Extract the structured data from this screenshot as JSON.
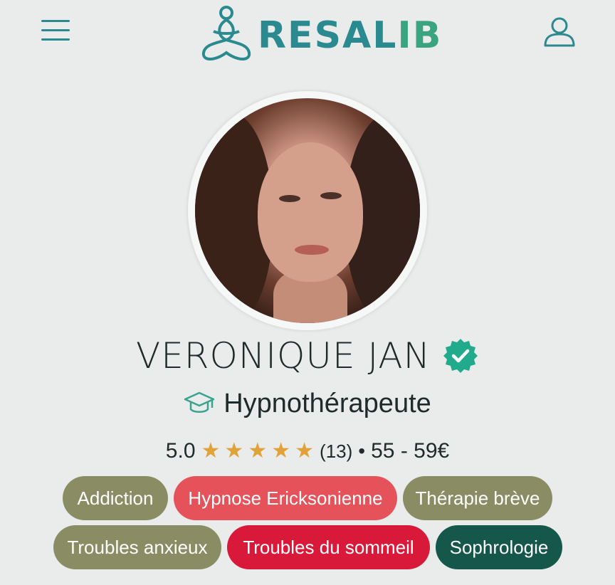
{
  "header": {
    "brand": "RESALIB",
    "brand_part1": "RESAL",
    "brand_part2": "IB",
    "menu_icon": "hamburger-menu-icon",
    "user_icon": "user-account-icon",
    "colors": {
      "teal": "#2a8a8f",
      "green": "#3aa37f"
    }
  },
  "profile": {
    "name": "VERONIQUE JAN",
    "verified_icon": "verified-badge-icon",
    "profession": "Hypnothérapeute",
    "profession_icon": "graduation-cap-icon",
    "rating": "5.0",
    "stars": 5,
    "reviews": "(13)",
    "separator": "•",
    "price": "55 - 59€"
  },
  "tags": [
    {
      "label": "Addiction",
      "color": "#8a8d64"
    },
    {
      "label": "Hypnose Ericksonienne",
      "color": "#e6525a"
    },
    {
      "label": "Thérapie brève",
      "color": "#8a8d64"
    },
    {
      "label": "Troubles anxieux",
      "color": "#8a8d64"
    },
    {
      "label": "Troubles du sommeil",
      "color": "#d9193a"
    },
    {
      "label": "Sophrologie",
      "color": "#15574a"
    }
  ]
}
